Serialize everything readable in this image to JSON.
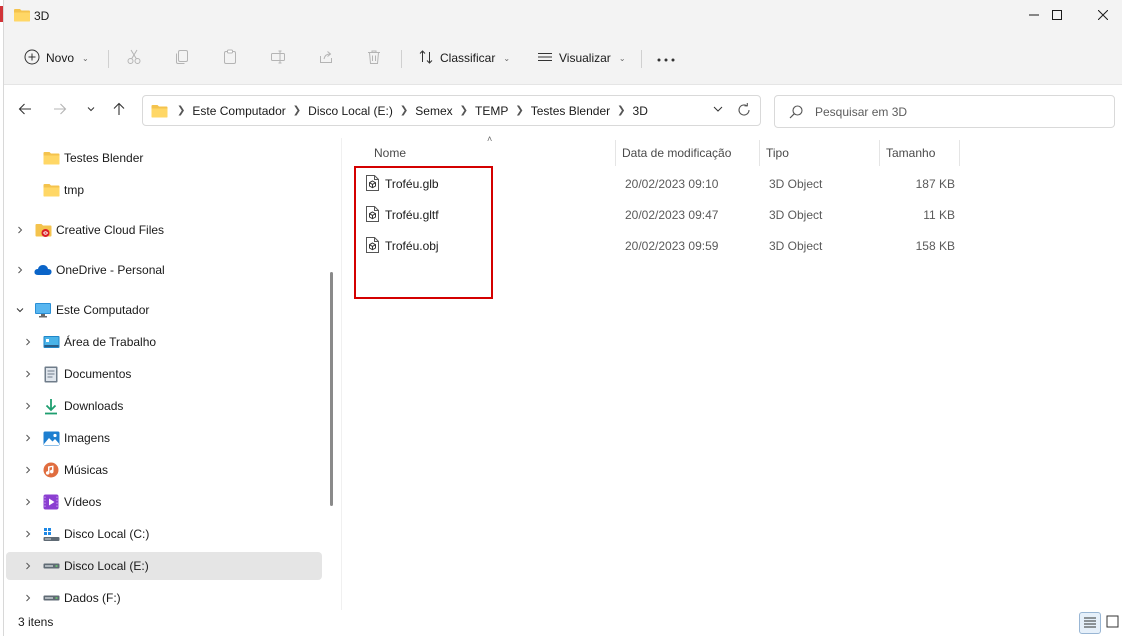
{
  "window": {
    "title": "3D"
  },
  "window_controls": {
    "minimize_icon": "minimize-icon",
    "maximize_icon": "maximize-icon",
    "close_icon": "close-icon"
  },
  "toolbar": {
    "new_label": "Novo",
    "sort_label": "Classificar",
    "view_label": "Visualizar",
    "icons": [
      "plus-circle-icon",
      "cut-icon",
      "copy-icon",
      "paste-icon",
      "rename-icon",
      "share-icon",
      "delete-icon",
      "sort-icon",
      "view-icon",
      "more-icon"
    ]
  },
  "breadcrumb": [
    "Este Computador",
    "Disco Local (E:)",
    "Semex",
    "TEMP",
    "Testes Blender",
    "3D"
  ],
  "search": {
    "placeholder": "Pesquisar em 3D"
  },
  "sidebar": {
    "items": [
      {
        "label": "Testes Blender",
        "icon": "folder-icon",
        "chevron": false
      },
      {
        "label": "tmp",
        "icon": "folder-icon",
        "chevron": false
      },
      {
        "label": "Creative Cloud Files",
        "icon": "creative-cloud-folder-icon",
        "chevron": true
      },
      {
        "label": "OneDrive - Personal",
        "icon": "onedrive-cloud-icon",
        "chevron": true
      },
      {
        "label": "Este Computador",
        "icon": "computer-icon",
        "chevron": true,
        "expanded": true
      },
      {
        "label": "Área de Trabalho",
        "icon": "desktop-icon",
        "chevron": true
      },
      {
        "label": "Documentos",
        "icon": "documents-icon",
        "chevron": true
      },
      {
        "label": "Downloads",
        "icon": "download-icon",
        "chevron": true
      },
      {
        "label": "Imagens",
        "icon": "pictures-icon",
        "chevron": true
      },
      {
        "label": "Músicas",
        "icon": "music-icon",
        "chevron": true
      },
      {
        "label": "Vídeos",
        "icon": "videos-icon",
        "chevron": true
      },
      {
        "label": "Disco Local (C:)",
        "icon": "system-drive-icon",
        "chevron": true
      },
      {
        "label": "Disco Local (E:)",
        "icon": "drive-icon",
        "chevron": true,
        "selected": true
      },
      {
        "label": "Dados (F:)",
        "icon": "drive-icon",
        "chevron": true
      }
    ]
  },
  "file_list": {
    "columns": [
      "Nome",
      "Data de modificação",
      "Tipo",
      "Tamanho"
    ],
    "rows": [
      {
        "name": "Troféu.glb",
        "modified": "20/02/2023 09:10",
        "type": "3D Object",
        "size": "187 KB"
      },
      {
        "name": "Troféu.gltf",
        "modified": "20/02/2023 09:47",
        "type": "3D Object",
        "size": "11 KB"
      },
      {
        "name": "Troféu.obj",
        "modified": "20/02/2023 09:59",
        "type": "3D Object",
        "size": "158 KB"
      }
    ]
  },
  "status": {
    "item_count": "3 itens"
  },
  "colors": {
    "accent": "#0067c0",
    "highlight_box": "#d40000",
    "folder": "#f4c34d",
    "selected_row": "#e5e5e5"
  }
}
